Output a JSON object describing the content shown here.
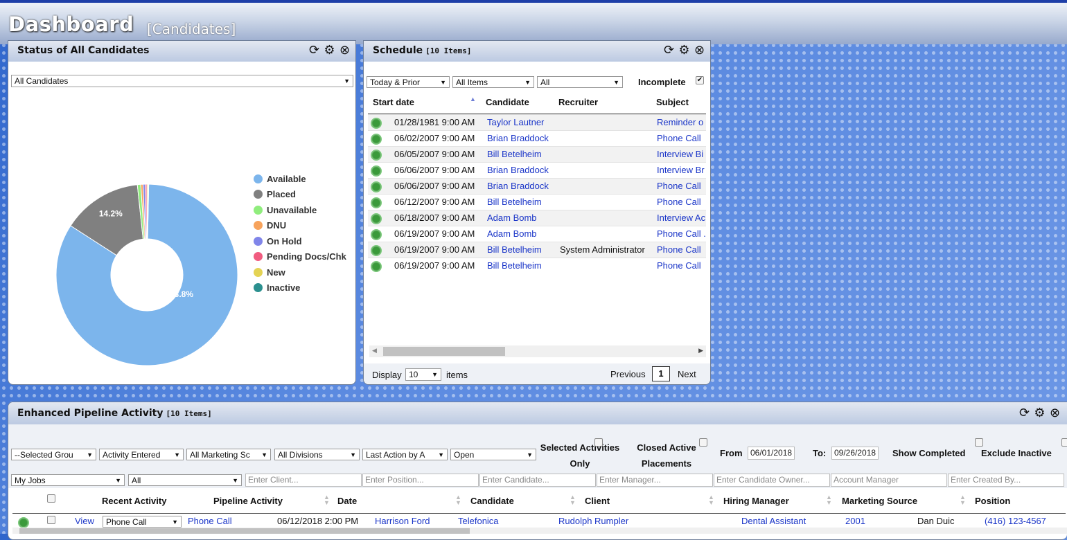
{
  "header": {
    "title": "Dashboard",
    "subtitle": "[Candidates]"
  },
  "status_panel": {
    "title": "Status of All Candidates",
    "filter": "All Candidates",
    "legend": [
      {
        "label": "Available",
        "color": "#7cb5ec"
      },
      {
        "label": "Placed",
        "color": "#808080"
      },
      {
        "label": "Unavailable",
        "color": "#90ed7d"
      },
      {
        "label": "DNU",
        "color": "#f7a35c"
      },
      {
        "label": "On Hold",
        "color": "#8085e9"
      },
      {
        "label": "Pending Docs/Chk",
        "color": "#f15c80"
      },
      {
        "label": "New",
        "color": "#e4d354"
      },
      {
        "label": "Inactive",
        "color": "#2b908f"
      }
    ]
  },
  "chart_data": {
    "type": "pie",
    "title": "",
    "categories": [
      "Available",
      "Placed",
      "Unavailable",
      "DNU",
      "On Hold",
      "Pending Docs/Chk",
      "New",
      "Inactive"
    ],
    "values": [
      83.8,
      14.2,
      0.6,
      0.4,
      0.4,
      0.3,
      0.2,
      0.1
    ],
    "data_labels": [
      "83.8%",
      "14.2%"
    ],
    "colors": [
      "#7cb5ec",
      "#808080",
      "#90ed7d",
      "#f7a35c",
      "#8085e9",
      "#f15c80",
      "#e4d354",
      "#2b908f"
    ],
    "legend": "right"
  },
  "schedule": {
    "title": "Schedule",
    "count": "[10 Items]",
    "filters": {
      "range": "Today & Prior",
      "items": "All Items",
      "scope": "All"
    },
    "incomplete_label": "Incomplete",
    "columns": [
      "Start date",
      "Candidate",
      "Recruiter",
      "Subject"
    ],
    "rows": [
      {
        "date": "01/28/1981 9:00 AM",
        "candidate": "Taylor Lautner",
        "recruiter": "",
        "subject": "Reminder o"
      },
      {
        "date": "06/02/2007 9:00 AM",
        "candidate": "Brian Braddock",
        "recruiter": "",
        "subject": "Phone Call"
      },
      {
        "date": "06/05/2007 9:00 AM",
        "candidate": "Bill Betelheim",
        "recruiter": "",
        "subject": "Interview Bi"
      },
      {
        "date": "06/06/2007 9:00 AM",
        "candidate": "Brian Braddock",
        "recruiter": "",
        "subject": "Interview Br"
      },
      {
        "date": "06/06/2007 9:00 AM",
        "candidate": "Brian Braddock",
        "recruiter": "",
        "subject": "Phone Call"
      },
      {
        "date": "06/12/2007 9:00 AM",
        "candidate": "Bill Betelheim",
        "recruiter": "",
        "subject": "Phone Call"
      },
      {
        "date": "06/18/2007 9:00 AM",
        "candidate": "Adam Bomb",
        "recruiter": "",
        "subject": "Interview Ac"
      },
      {
        "date": "06/19/2007 9:00 AM",
        "candidate": "Adam Bomb",
        "recruiter": "",
        "subject": "Phone Call ."
      },
      {
        "date": "06/19/2007 9:00 AM",
        "candidate": "Bill Betelheim",
        "recruiter": "System Administrator",
        "subject": "Phone Call"
      },
      {
        "date": "06/19/2007 9:00 AM",
        "candidate": "Bill Betelheim",
        "recruiter": "",
        "subject": "Phone Call"
      }
    ],
    "display_label": "Display",
    "page_size": "10",
    "items_label": "items",
    "prev": "Previous",
    "page": "1",
    "next": "Next"
  },
  "pipeline": {
    "title": "Enhanced Pipeline Activity",
    "count": "[10 Items]",
    "filters": [
      "--Selected Grou",
      "Activity Entered",
      "All Marketing Sc",
      "All Divisions",
      "Last Action by A",
      "Open"
    ],
    "selected_activities": "Selected Activities Only",
    "closed_active": "Closed Active Placements",
    "from_label": "From",
    "from_value": "06/01/2018",
    "to_label": "To:",
    "to_value": "09/26/2018",
    "show_completed": "Show Completed",
    "exclude_inactive": "Exclude Inactive",
    "second_filters": [
      "My Jobs",
      "All"
    ],
    "search_placeholders": [
      "Enter Client...",
      "Enter Position...",
      "Enter Candidate...",
      "Enter Manager...",
      "Enter Candidate Owner...",
      "Account Manager",
      "Enter Created By..."
    ],
    "columns": [
      "Recent Activity",
      "Pipeline Activity",
      "Date",
      "Candidate",
      "Client",
      "Hiring Manager",
      "Marketing Source",
      "Position"
    ],
    "row": {
      "view": "View",
      "recent": "Phone Call",
      "pipeline": "Phone Call",
      "date": "06/12/2018 2:00 PM",
      "candidate": "Harrison Ford",
      "client": "Telefonica",
      "manager": "Rudolph Rumpler",
      "source": "Dental Assistant",
      "position": "2001",
      "owner": "Dan Duic",
      "phone": "(416) 123-4567"
    }
  }
}
